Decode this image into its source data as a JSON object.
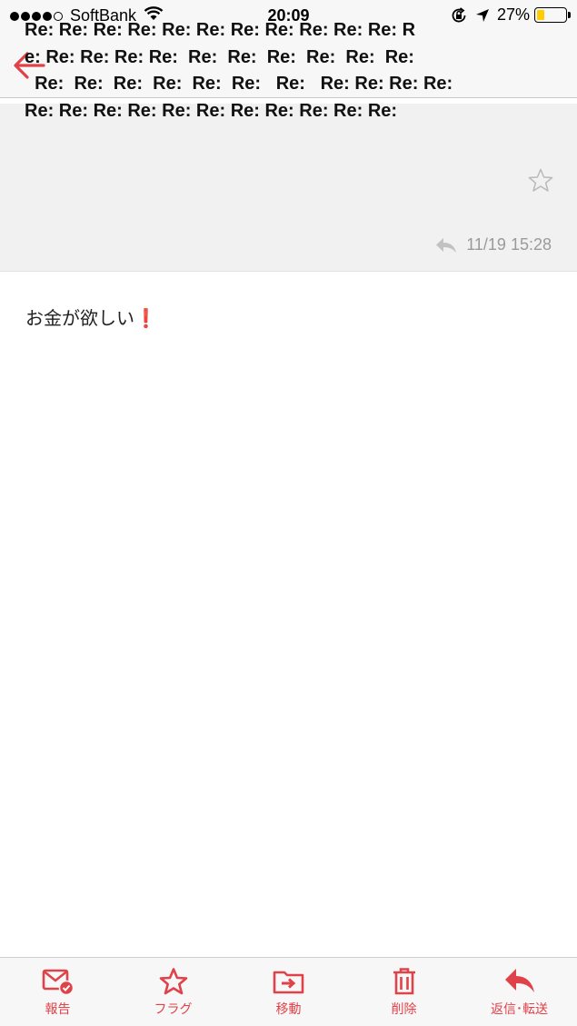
{
  "status_bar": {
    "carrier": "SoftBank",
    "time": "20:09",
    "battery_percent": "27%",
    "battery_level": 0.27,
    "signal_bars_filled": 4,
    "signal_bars_total": 5,
    "icons": [
      "wifi-icon",
      "rotation-lock-icon",
      "location-arrow-icon",
      "battery-icon"
    ]
  },
  "nav": {
    "back_icon": "arrow-left-icon"
  },
  "message": {
    "subject_lines": [
      "Re: Re: Re: Re: Re: Re: Re: Re: Re: Re: Re: R",
      "e: Re: Re: Re: Re:  Re:  Re:  Re:  Re:  Re:  Re:",
      "  Re:  Re:  Re:  Re:  Re:  Re:   Re:   Re: Re: Re: Re:",
      "Re: Re: Re: Re: Re: Re: Re: Re: Re: Re: Re:"
    ],
    "date": "11/19 15:28",
    "body_text": "お金が欲しい",
    "body_emoji": "❗",
    "accent_color": "#e0424a"
  },
  "toolbar": {
    "report_label": "報告",
    "flag_label": "フラグ",
    "move_label": "移動",
    "delete_label": "削除",
    "reply_label": "返信･転送"
  }
}
